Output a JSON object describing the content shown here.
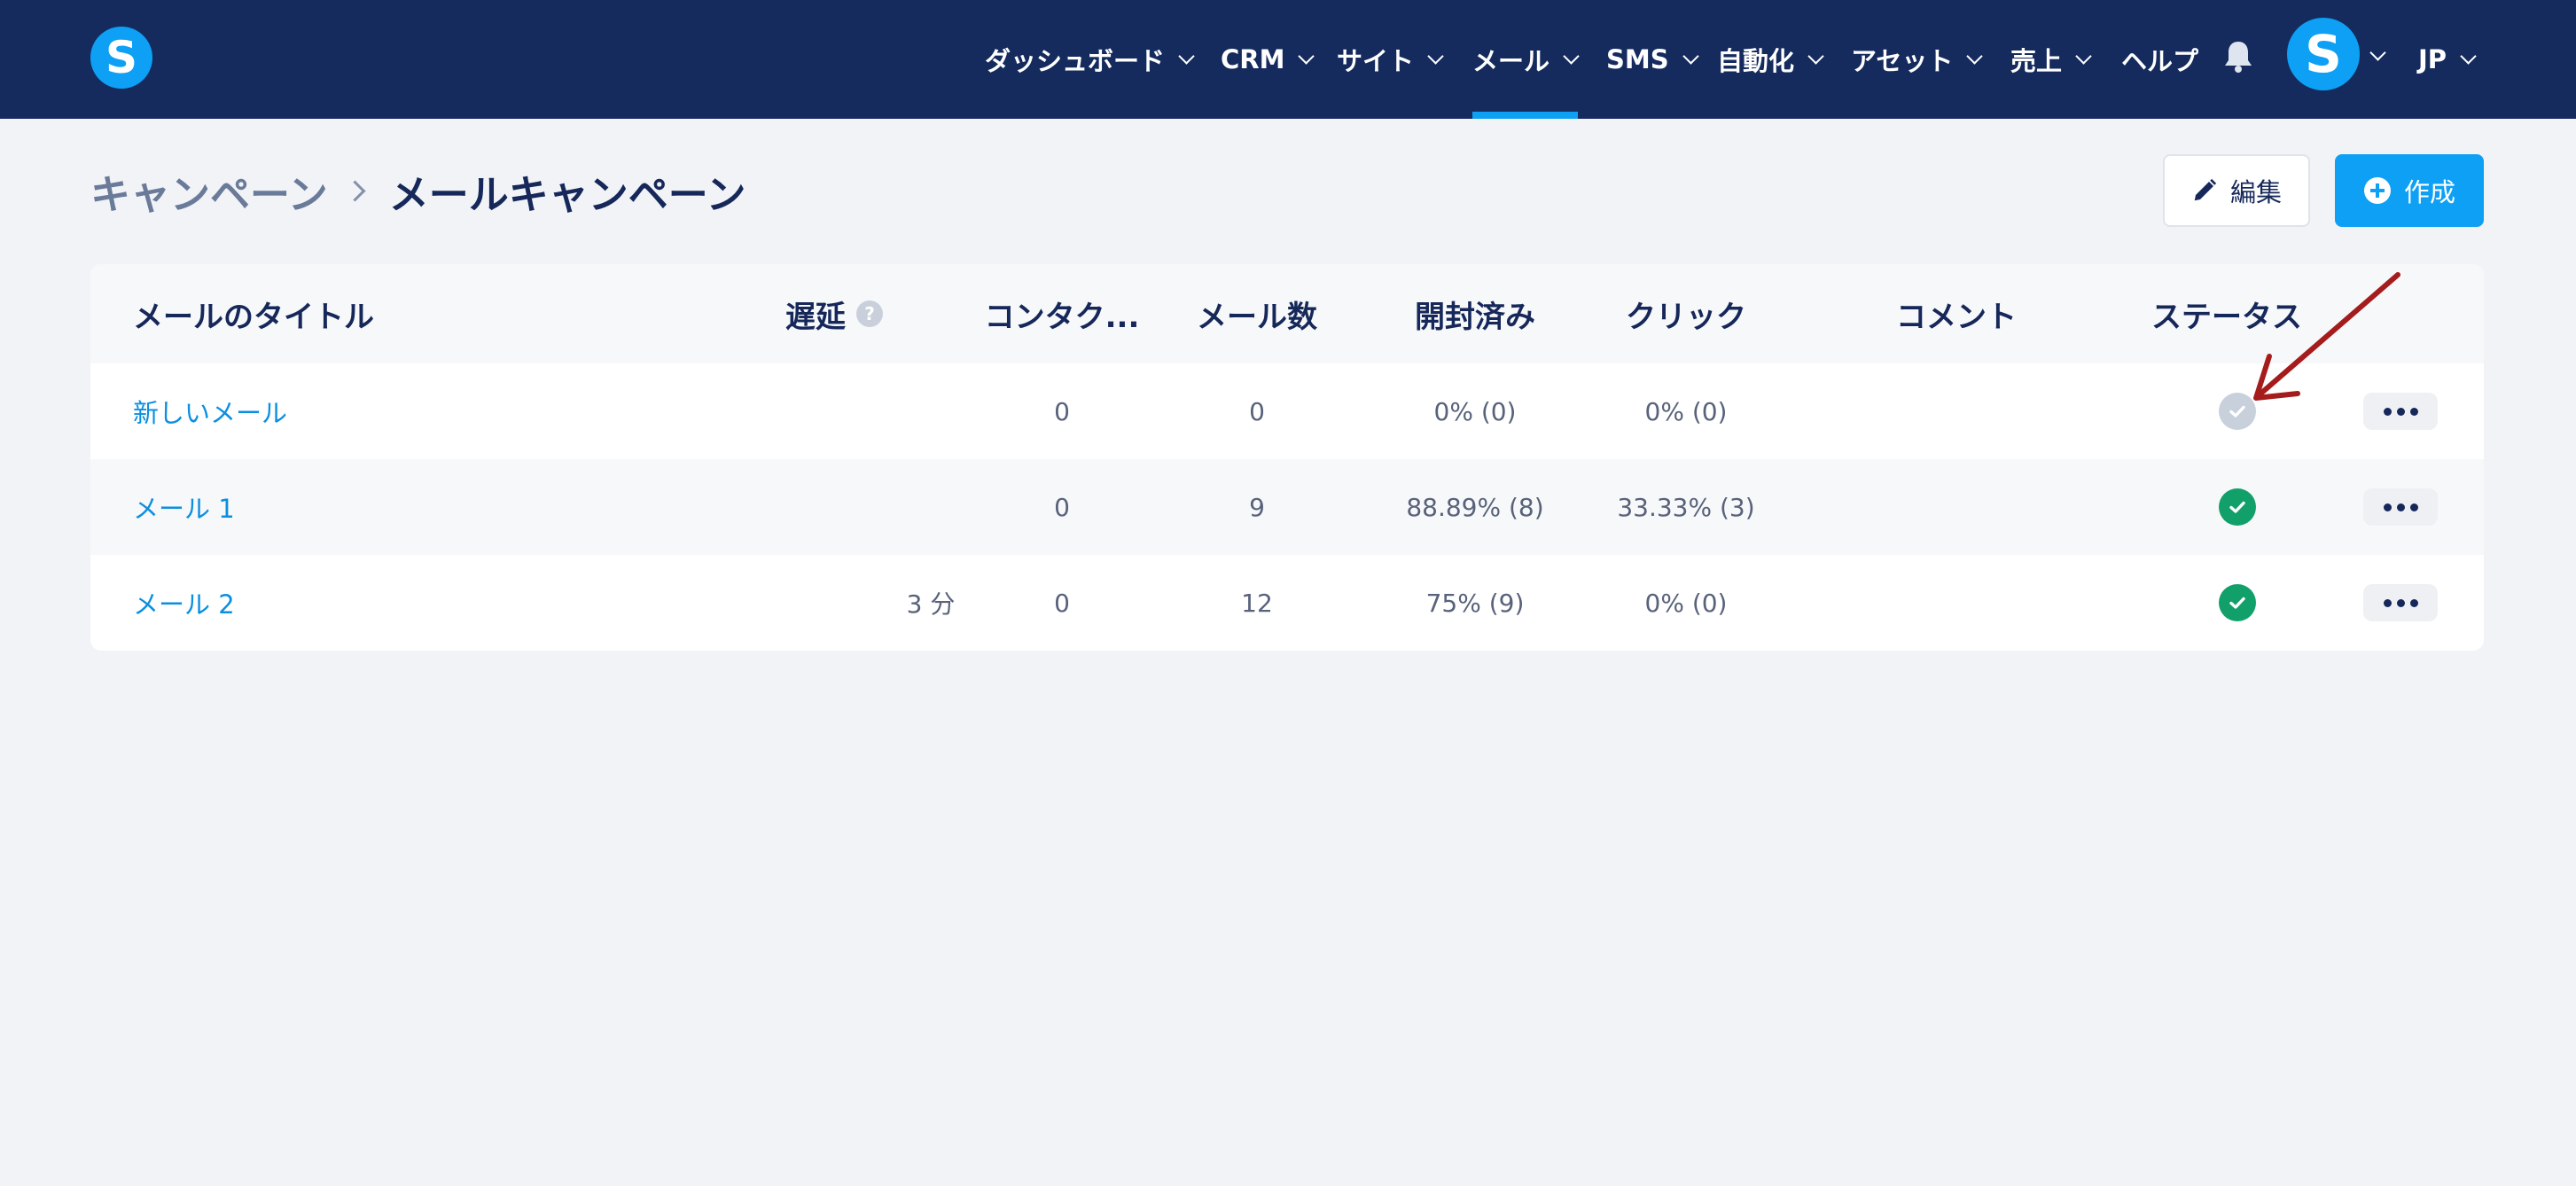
{
  "nav": {
    "logo_letter": "S",
    "items": [
      {
        "label": "ダッシュボード",
        "active": false
      },
      {
        "label": "CRM",
        "active": false
      },
      {
        "label": "サイト",
        "active": false
      },
      {
        "label": "メール",
        "active": true
      },
      {
        "label": "SMS",
        "active": false
      },
      {
        "label": "自動化",
        "active": false
      },
      {
        "label": "アセット",
        "active": false
      },
      {
        "label": "売上",
        "active": false
      },
      {
        "label": "ヘルプ",
        "active": false
      }
    ],
    "avatar_letter": "S",
    "language": "JP"
  },
  "breadcrumb": {
    "parent": "キャンペーン",
    "current": "メールキャンペーン"
  },
  "actions": {
    "edit_label": "編集",
    "create_label": "作成"
  },
  "table": {
    "columns": {
      "title": "メールのタイトル",
      "delay": "遅延",
      "contacts": "コンタク...",
      "mails": "メール数",
      "opened": "開封済み",
      "clicks": "クリック",
      "comment": "コメント",
      "status": "ステータス"
    },
    "delay_help": "?",
    "rows": [
      {
        "title": "新しいメール",
        "delay": "",
        "contacts": "0",
        "mails": "0",
        "opened": "0% (0)",
        "clicks": "0% (0)",
        "comment": "",
        "status": "inactive"
      },
      {
        "title": "メール 1",
        "delay": "",
        "contacts": "0",
        "mails": "9",
        "opened": "88.89% (8)",
        "clicks": "33.33% (3)",
        "comment": "",
        "status": "active"
      },
      {
        "title": "メール 2",
        "delay": "3 分",
        "contacts": "0",
        "mails": "12",
        "opened": "75% (9)",
        "clicks": "0% (0)",
        "comment": "",
        "status": "active"
      }
    ]
  },
  "colors": {
    "nav_bg": "#152b5e",
    "accent": "#0da0f5",
    "status_active": "#12a06a",
    "status_inactive": "#c8d0dc",
    "annotation_arrow": "#a51c1c"
  }
}
